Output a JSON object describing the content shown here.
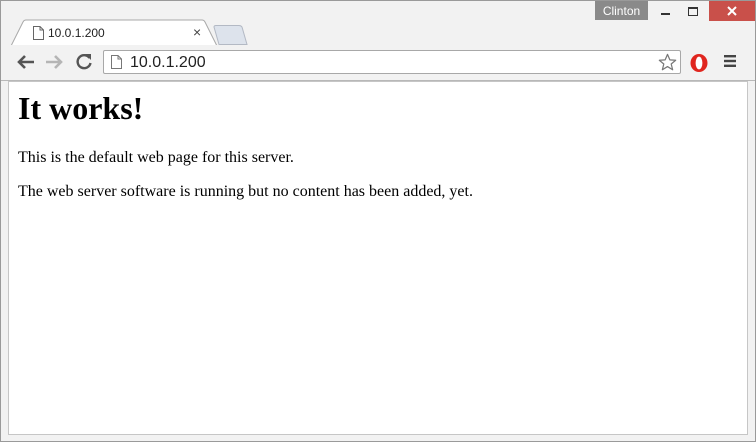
{
  "window": {
    "user_name": "Clinton"
  },
  "tab": {
    "title": "10.0.1.200",
    "close_label": "×"
  },
  "toolbar": {
    "url": "10.0.1.200"
  },
  "page": {
    "heading": "It works!",
    "paragraph1": "This is the default web page for this server.",
    "paragraph2": "The web server software is running but no content has been added, yet."
  },
  "colors": {
    "close_button": "#c9504a",
    "user_badge": "#8a8a8a",
    "tab_background": "#ffffff",
    "new_tab": "#dde3ec",
    "opera_red": "#e0261f"
  },
  "icons": [
    "document-icon",
    "back-arrow-icon",
    "forward-arrow-icon",
    "reload-icon",
    "star-icon",
    "opera-icon",
    "menu-icon",
    "minimize-icon",
    "maximize-icon",
    "close-icon"
  ]
}
